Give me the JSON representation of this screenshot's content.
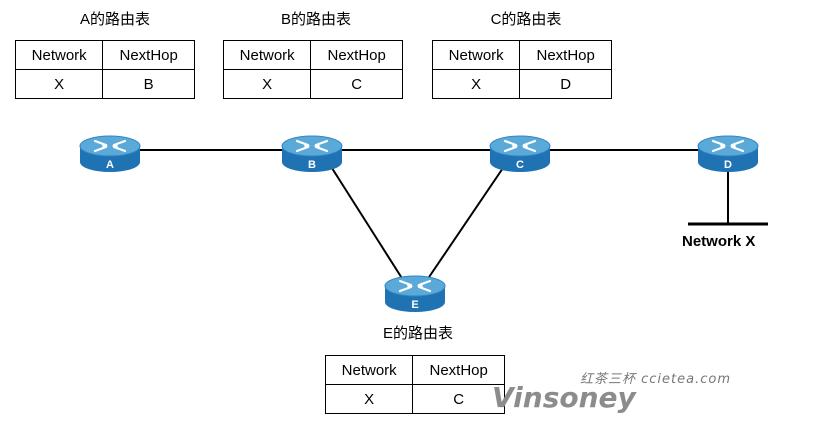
{
  "tables": {
    "A": {
      "title": "A的路由表",
      "header": [
        "Network",
        "NextHop"
      ],
      "row": [
        "X",
        "B"
      ]
    },
    "B": {
      "title": "B的路由表",
      "header": [
        "Network",
        "NextHop"
      ],
      "row": [
        "X",
        "C"
      ]
    },
    "C": {
      "title": "C的路由表",
      "header": [
        "Network",
        "NextHop"
      ],
      "row": [
        "X",
        "D"
      ]
    },
    "E": {
      "title": "E的路由表",
      "header": [
        "Network",
        "NextHop"
      ],
      "row": [
        "X",
        "C"
      ]
    }
  },
  "routers": [
    {
      "id": "A",
      "label": "A"
    },
    {
      "id": "B",
      "label": "B"
    },
    {
      "id": "C",
      "label": "C"
    },
    {
      "id": "D",
      "label": "D"
    },
    {
      "id": "E",
      "label": "E"
    }
  ],
  "network_label": "Network X",
  "watermark": {
    "top": "红茶三杯 ccietea.com",
    "brand": "Vinsoney"
  },
  "colors": {
    "router_top": "#5aa9d8",
    "router_side": "#1f73b3",
    "link": "#000000"
  }
}
